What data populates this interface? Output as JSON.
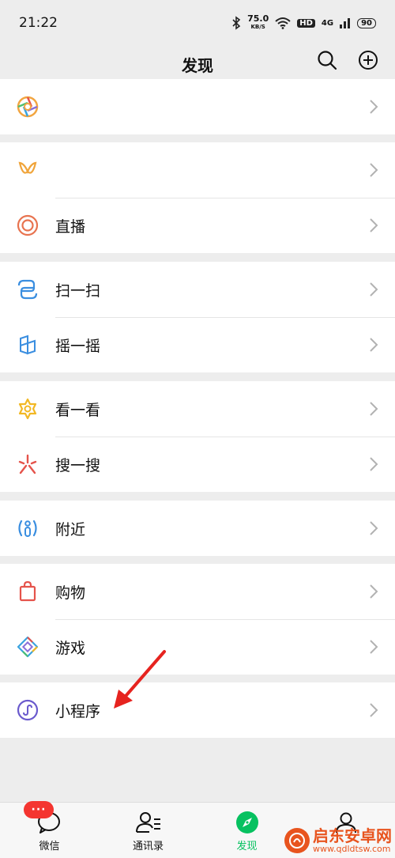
{
  "status_bar": {
    "time": "21:22",
    "speed_value": "75.0",
    "speed_unit": "KB/S",
    "hd": "HD",
    "network": "4G",
    "battery": "90"
  },
  "nav": {
    "title": "发现"
  },
  "groups": [
    {
      "items": [
        {
          "label": ""
        }
      ]
    },
    {
      "items": [
        {
          "label": ""
        },
        {
          "label": "直播"
        }
      ]
    },
    {
      "items": [
        {
          "label": "扫一扫"
        },
        {
          "label": "摇一摇"
        }
      ]
    },
    {
      "items": [
        {
          "label": "看一看"
        },
        {
          "label": "搜一搜"
        }
      ]
    },
    {
      "items": [
        {
          "label": "附近"
        }
      ]
    },
    {
      "items": [
        {
          "label": "购物"
        },
        {
          "label": "游戏"
        }
      ]
    },
    {
      "items": [
        {
          "label": "小程序"
        }
      ]
    }
  ],
  "tabs": [
    {
      "label": "微信",
      "badge": "···"
    },
    {
      "label": "通讯录"
    },
    {
      "label": "发现"
    },
    {
      "label": ""
    }
  ],
  "colors": {
    "accent_green": "#07c160",
    "badge_red": "#f43530",
    "annotation_red": "#e6231f"
  },
  "watermark": {
    "title": "启东安卓网",
    "url": "www.qdldtsw.com"
  }
}
